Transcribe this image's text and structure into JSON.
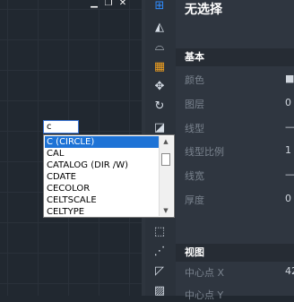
{
  "window": {
    "buttons": {
      "minimize": "▁",
      "restore": "❐",
      "close": "✕"
    }
  },
  "toolbar": {
    "icons": [
      "select-icon",
      "mirror-icon",
      "block-icon",
      "grid-icon",
      "move-icon",
      "rotate-icon",
      "match-icon",
      "rectangle-icon",
      "linetype-icon",
      "line-icon",
      "hatch-icon"
    ]
  },
  "properties": {
    "title": "无选择",
    "basic": {
      "header": "基本",
      "rows": [
        {
          "label": "颜色",
          "value": "■"
        },
        {
          "label": "图层",
          "value": "0"
        },
        {
          "label": "线型",
          "value": "—"
        },
        {
          "label": "线型比例",
          "value": "1"
        },
        {
          "label": "线宽",
          "value": "—"
        },
        {
          "label": "厚度",
          "value": "0"
        }
      ]
    },
    "view": {
      "header": "视图",
      "rows": [
        {
          "label": "中心点 X",
          "value": "42"
        },
        {
          "label": "中心点 Y",
          "value": ""
        }
      ]
    }
  },
  "command": {
    "input_value": "c",
    "suggestions": [
      "C (CIRCLE)",
      "CAL",
      "CATALOG (DIR /W)",
      "CDATE",
      "CECOLOR",
      "CELTSCALE",
      "CELTYPE"
    ],
    "selected_index": 0
  }
}
